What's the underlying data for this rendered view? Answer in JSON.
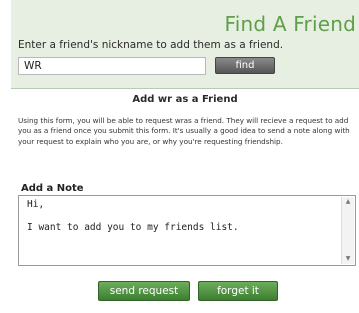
{
  "header": {
    "title": "Find A Friend",
    "instruction": "Enter a friend's nickname to add them as a friend."
  },
  "search": {
    "value": "WR",
    "find_label": "find"
  },
  "request": {
    "heading": "Add wr as a Friend",
    "description": "Using this form, you will be able to request wras a friend. They will recieve a request to add you as a friend once you submit this form. It's usually a good idea to send a note along with your request to explain who you are, or why you're requesting friendship.",
    "note_label": "Add a Note",
    "note_text": "Hi,\n\nI want to add you to my friends list."
  },
  "actions": {
    "send_label": "send request",
    "forget_label": "forget it"
  },
  "colors": {
    "title": "#5f9f4a",
    "panel": "#e7efe3",
    "button_green": "#4e8f40",
    "button_gray": "#6e6e6e"
  },
  "icons": {
    "scroll_up": "scroll-up-arrow-icon",
    "scroll_down": "scroll-down-arrow-icon"
  }
}
